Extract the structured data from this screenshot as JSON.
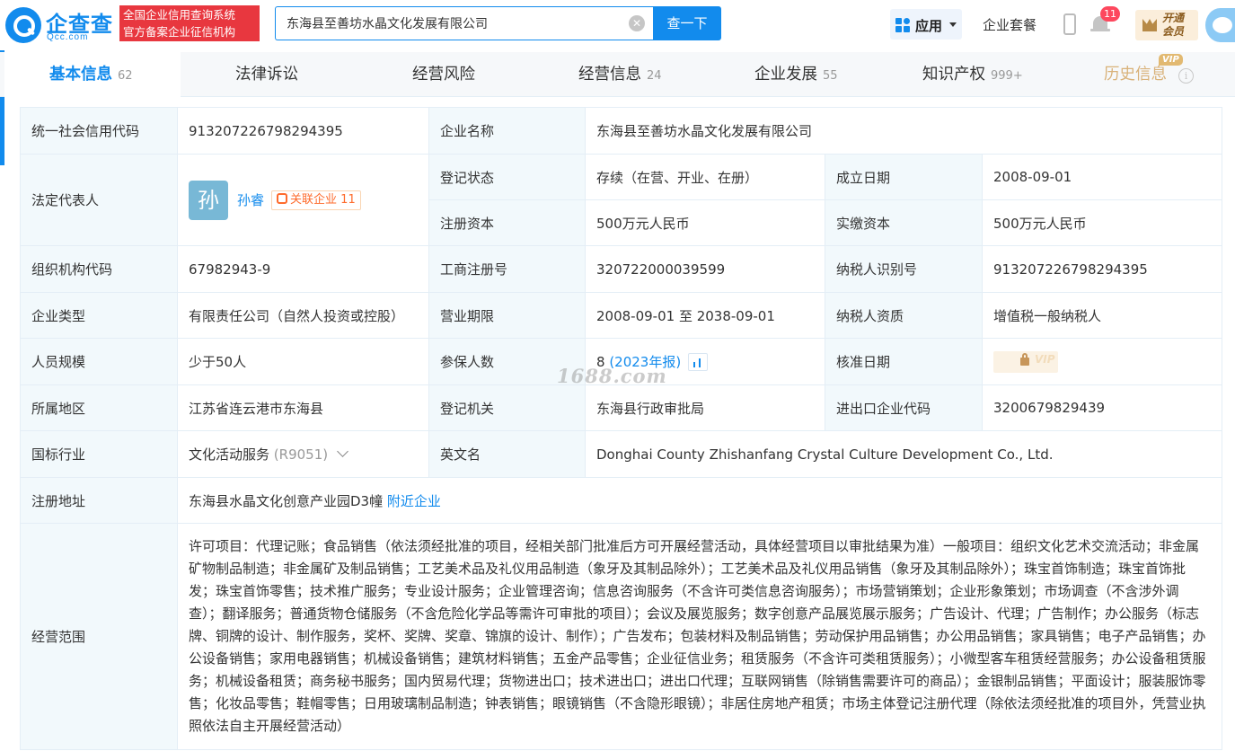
{
  "header": {
    "logo_text": "企查查",
    "logo_sub": "Qcc.com",
    "badge_line1": "全国企业信用查询系统",
    "badge_line2": "官方备案企业征信机构",
    "search_value": "东海县至善坊水晶文化发展有限公司",
    "search_button": "查一下",
    "app_label": "应用",
    "package_link": "企业套餐",
    "notification_count": "11",
    "vip_line1": "开通",
    "vip_line2": "会员"
  },
  "tabs": [
    {
      "label": "基本信息",
      "count": "62"
    },
    {
      "label": "法律诉讼",
      "count": ""
    },
    {
      "label": "经营风险",
      "count": ""
    },
    {
      "label": "经营信息",
      "count": "24"
    },
    {
      "label": "企业发展",
      "count": "55"
    },
    {
      "label": "知识产权",
      "count": "999+"
    },
    {
      "label": "历史信息",
      "count": "",
      "tag": "VIP"
    }
  ],
  "info": {
    "credit_code_label": "统一社会信用代码",
    "credit_code": "913207226798294395",
    "company_name_label": "企业名称",
    "company_name": "东海县至善坊水晶文化发展有限公司",
    "legal_rep_label": "法定代表人",
    "legal_rep_avatar": "孙",
    "legal_rep_name": "孙睿",
    "related_label": "关联企业",
    "related_count": "11",
    "reg_status_label": "登记状态",
    "reg_status": "存续（在营、开业、在册）",
    "found_date_label": "成立日期",
    "found_date": "2008-09-01",
    "reg_capital_label": "注册资本",
    "reg_capital": "500万元人民币",
    "paid_capital_label": "实缴资本",
    "paid_capital": "500万元人民币",
    "org_code_label": "组织机构代码",
    "org_code": "67982943-9",
    "biz_reg_no_label": "工商注册号",
    "biz_reg_no": "320722000039599",
    "taxpayer_id_label": "纳税人识别号",
    "taxpayer_id": "913207226798294395",
    "company_type_label": "企业类型",
    "company_type": "有限责任公司（自然人投资或控股）",
    "biz_term_label": "营业期限",
    "biz_term": "2008-09-01 至 2038-09-01",
    "taxpayer_qual_label": "纳税人资质",
    "taxpayer_qual": "增值税一般纳税人",
    "staff_size_label": "人员规模",
    "staff_size": "少于50人",
    "insured_label": "参保人数",
    "insured_count": "8",
    "insured_year": "(2023年报)",
    "approval_date_label": "核准日期",
    "approval_vip": "VIP",
    "region_label": "所属地区",
    "region": "江苏省连云港市东海县",
    "reg_authority_label": "登记机关",
    "reg_authority": "东海县行政审批局",
    "ie_code_label": "进出口企业代码",
    "ie_code": "3200679829439",
    "industry_label": "国标行业",
    "industry": "文化活动服务",
    "industry_code": "(R9051)",
    "english_name_label": "英文名",
    "english_name": "Donghai County Zhishanfang Crystal Culture Development Co., Ltd.",
    "address_label": "注册地址",
    "address": "东海县水晶文化创意产业园D3幢",
    "nearby_link": "附近企业",
    "scope_label": "经营范围",
    "scope": "许可项目：代理记账；食品销售（依法须经批准的项目，经相关部门批准后方可开展经营活动，具体经营项目以审批结果为准）一般项目：组织文化艺术交流活动；非金属矿物制品制造；非金属矿及制品销售；工艺美术品及礼仪用品制造（象牙及其制品除外）；工艺美术品及礼仪用品销售（象牙及其制品除外）；珠宝首饰制造；珠宝首饰批发；珠宝首饰零售；技术推广服务；专业设计服务；企业管理咨询；信息咨询服务（不含许可类信息咨询服务）；市场营销策划；企业形象策划；市场调查（不含涉外调查）；翻译服务；普通货物仓储服务（不含危险化学品等需许可审批的项目）；会议及展览服务；数字创意产品展览展示服务；广告设计、代理；广告制作；办公服务（标志牌、铜牌的设计、制作服务，奖杯、奖牌、奖章、锦旗的设计、制作）；广告发布；包装材料及制品销售；劳动保护用品销售；办公用品销售；家具销售；电子产品销售；办公设备销售；家用电器销售；机械设备销售；建筑材料销售；五金产品零售；企业征信业务；租赁服务（不含许可类租赁服务）；小微型客车租赁经营服务；办公设备租赁服务；机械设备租赁；商务秘书服务；国内贸易代理；货物进出口；技术进出口；进出口代理；互联网销售（除销售需要许可的商品）；金银制品销售；平面设计；服装服饰零售；化妆品零售；鞋帽零售；日用玻璃制品制造；钟表销售；眼镜销售（不含隐形眼镜）；非居住房地产租赁；市场主体登记注册代理（除依法须经批准的项目外，凭营业执照依法自主开展经营活动）"
  },
  "watermark": "1688.com"
}
